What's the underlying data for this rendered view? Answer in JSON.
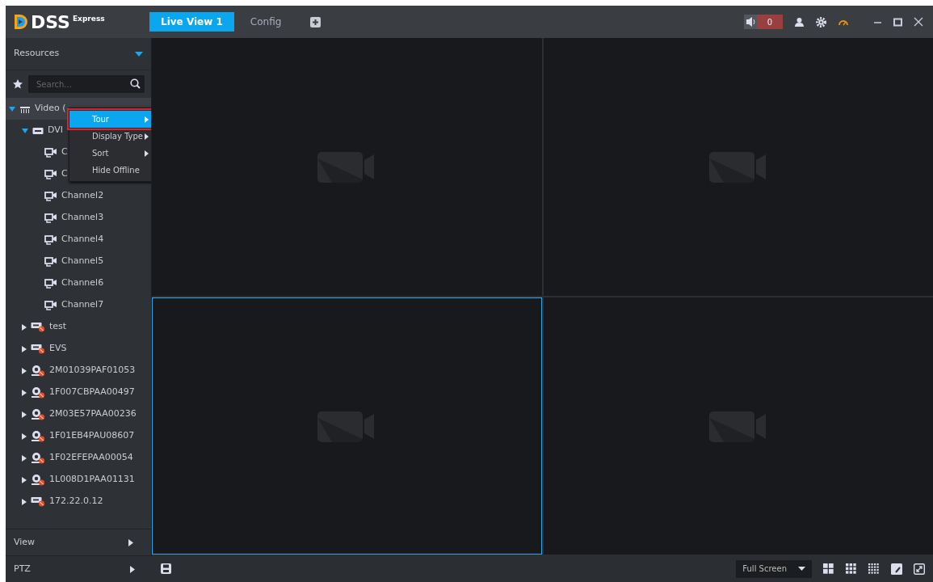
{
  "app": {
    "logo": "DSS",
    "logo_sup": "Express"
  },
  "tabs": [
    {
      "label": "Live View 1",
      "selected": true
    },
    {
      "label": "Config",
      "selected": false
    }
  ],
  "alarm": {
    "count": "0"
  },
  "sidebar": {
    "header": "Resources",
    "search": {
      "placeholder": "Search..."
    },
    "tree": [
      {
        "label": "Video (",
        "kind": "group",
        "expanded": true,
        "children": [
          {
            "label": "DVI",
            "kind": "dvr",
            "expanded": true,
            "children": [
              {
                "label": "C",
                "kind": "channel"
              },
              {
                "label": "C",
                "kind": "channel"
              },
              {
                "label": "Channel2",
                "kind": "channel"
              },
              {
                "label": "Channel3",
                "kind": "channel"
              },
              {
                "label": "Channel4",
                "kind": "channel"
              },
              {
                "label": "Channel5",
                "kind": "channel"
              },
              {
                "label": "Channel6",
                "kind": "channel"
              },
              {
                "label": "Channel7",
                "kind": "channel"
              }
            ]
          },
          {
            "label": "test",
            "kind": "dvr-offline",
            "expanded": false
          },
          {
            "label": "EVS",
            "kind": "dvr-offline",
            "expanded": false
          },
          {
            "label": "2M01039PAF01053",
            "kind": "camera-offline",
            "expanded": false
          },
          {
            "label": "1F007CBPAA00497",
            "kind": "camera-offline",
            "expanded": false
          },
          {
            "label": "2M03E57PAA00236",
            "kind": "camera-offline",
            "expanded": false
          },
          {
            "label": "1F01EB4PAU08607",
            "kind": "camera-offline",
            "expanded": false
          },
          {
            "label": "1F02EFEPAA00054",
            "kind": "camera-offline",
            "expanded": false
          },
          {
            "label": "1L008D1PAA01131",
            "kind": "camera-offline",
            "expanded": false
          },
          {
            "label": "172.22.0.12",
            "kind": "dvr-offline",
            "expanded": false
          }
        ]
      }
    ],
    "sections": [
      "View",
      "PTZ"
    ]
  },
  "context_menu": [
    {
      "label": "Tour",
      "submenu": true,
      "selected": true
    },
    {
      "label": "Display Type",
      "submenu": true,
      "selected": false
    },
    {
      "label": "Sort",
      "submenu": true,
      "selected": false
    },
    {
      "label": "Hide Offline",
      "submenu": false,
      "selected": false
    }
  ],
  "video_cells": [
    {
      "selected": false
    },
    {
      "selected": false
    },
    {
      "selected": true
    },
    {
      "selected": false
    }
  ],
  "toolbar": {
    "display_mode": "Full Screen"
  }
}
